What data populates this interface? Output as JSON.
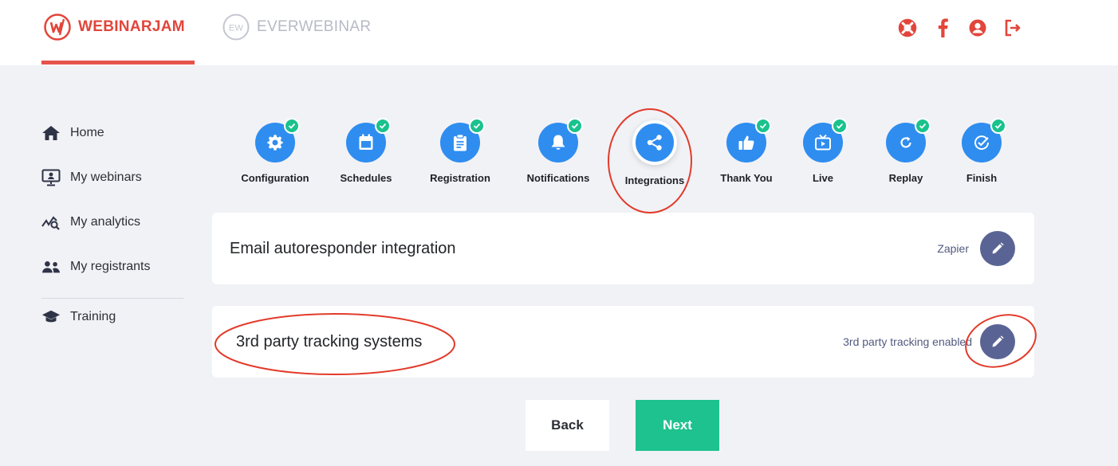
{
  "header": {
    "brand_primary": "WEBINARJAM",
    "brand_secondary": "EVERWEBINAR",
    "icons": [
      "support-icon",
      "facebook-icon",
      "account-icon",
      "logout-icon"
    ],
    "accent_color": "#e5534b"
  },
  "sidebar": {
    "items": [
      {
        "label": "Home",
        "icon": "home-icon"
      },
      {
        "label": "My webinars",
        "icon": "webinars-icon"
      },
      {
        "label": "My analytics",
        "icon": "analytics-icon"
      },
      {
        "label": "My registrants",
        "icon": "registrants-icon"
      },
      {
        "label": "Training",
        "icon": "graduation-cap-icon"
      }
    ]
  },
  "steps": [
    {
      "label": "Configuration",
      "icon": "gear-icon",
      "completed": true
    },
    {
      "label": "Schedules",
      "icon": "calendar-icon",
      "completed": true
    },
    {
      "label": "Registration",
      "icon": "clipboard-icon",
      "completed": true
    },
    {
      "label": "Notifications",
      "icon": "bell-icon",
      "completed": true
    },
    {
      "label": "Integrations",
      "icon": "share-icon",
      "completed": false,
      "active": true
    },
    {
      "label": "Thank You",
      "icon": "thumbs-up-icon",
      "completed": true
    },
    {
      "label": "Live",
      "icon": "tv-icon",
      "completed": true
    },
    {
      "label": "Replay",
      "icon": "replay-icon",
      "completed": true
    },
    {
      "label": "Finish",
      "icon": "check-circle-icon",
      "completed": true
    }
  ],
  "cards": [
    {
      "title": "Email autoresponder integration",
      "status": "Zapier"
    },
    {
      "title": "3rd party tracking systems",
      "status": "3rd party tracking enabled"
    }
  ],
  "actions": {
    "back_label": "Back",
    "next_label": "Next"
  },
  "colors": {
    "step_blue": "#2f8df0",
    "check_green": "#1ac28d",
    "edit_button": "#5a6494",
    "next_green": "#1ec28e",
    "annotation_red": "#e23b2a"
  }
}
